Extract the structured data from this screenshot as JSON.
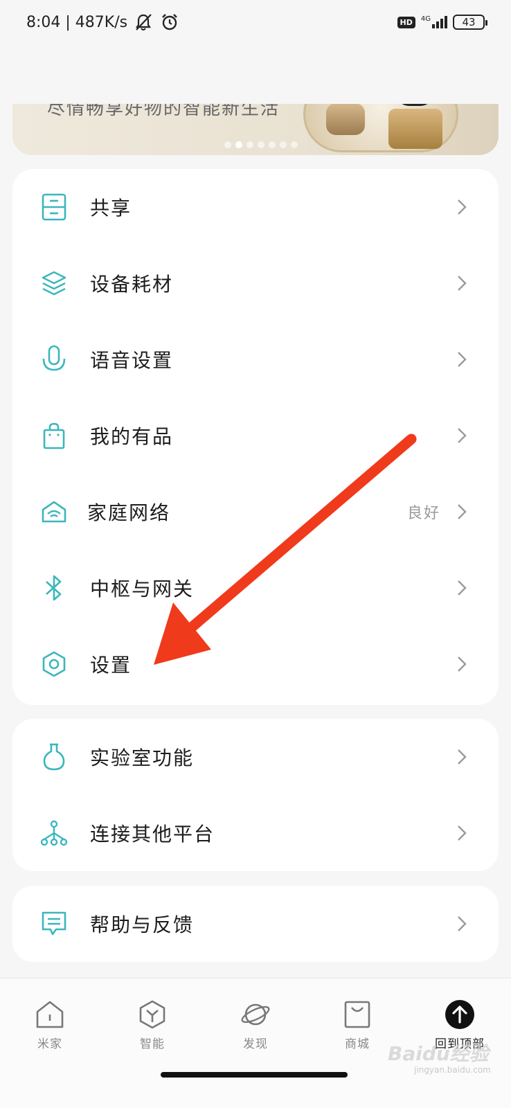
{
  "status_bar": {
    "time_speed": "8:04 | 487K/s",
    "hd": "HD",
    "network": "4G",
    "battery": "43"
  },
  "banner": {
    "partial_text": "尽情畅享好物的智能新生活"
  },
  "card_main": {
    "items": [
      {
        "label": "共享",
        "icon": "share-drawer-icon",
        "value": ""
      },
      {
        "label": "设备耗材",
        "icon": "layers-icon",
        "value": ""
      },
      {
        "label": "语音设置",
        "icon": "microphone-icon",
        "value": ""
      },
      {
        "label": "我的有品",
        "icon": "shopping-bag-icon",
        "value": ""
      },
      {
        "label": "家庭网络",
        "icon": "home-wifi-icon",
        "value": "良好"
      },
      {
        "label": "中枢与网关",
        "icon": "bluetooth-icon",
        "value": ""
      },
      {
        "label": "设置",
        "icon": "hexagon-settings-icon",
        "value": ""
      }
    ]
  },
  "card_lab": {
    "items": [
      {
        "label": "实验室功能",
        "icon": "flask-icon"
      },
      {
        "label": "连接其他平台",
        "icon": "network-tree-icon"
      }
    ]
  },
  "card_help": {
    "items": [
      {
        "label": "帮助与反馈",
        "icon": "message-icon"
      }
    ]
  },
  "bottom_nav": {
    "items": [
      {
        "label": "米家",
        "icon": "home-icon"
      },
      {
        "label": "智能",
        "icon": "smart-cube-icon"
      },
      {
        "label": "发现",
        "icon": "planet-icon"
      },
      {
        "label": "商城",
        "icon": "store-bag-icon"
      },
      {
        "label": "回到顶部",
        "icon": "back-to-top-icon"
      }
    ]
  },
  "watermark": {
    "text": "Baidu经验",
    "sub": "jingyan.baidu.com"
  },
  "colors": {
    "accent_teal": "#3bb6bd",
    "annotation_red": "#f03a1c",
    "background": "#f6f6f6"
  }
}
